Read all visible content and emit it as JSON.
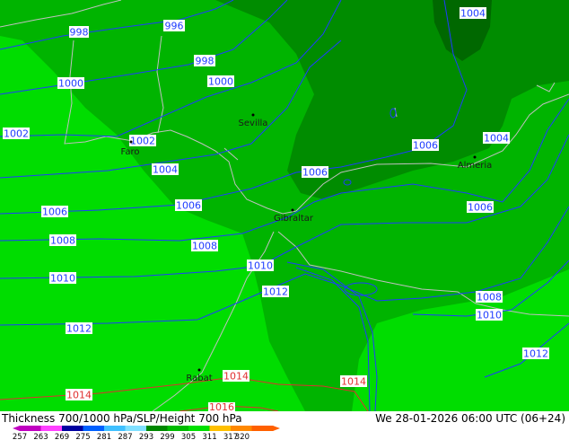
{
  "map": {
    "isobar_labels": [
      "998",
      "996",
      "998",
      "1000",
      "1000",
      "1002",
      "1002",
      "1004",
      "1004",
      "1004",
      "1006",
      "1006",
      "1006",
      "1006",
      "1006",
      "1008",
      "1008",
      "1008",
      "1010",
      "1010",
      "1010",
      "1012",
      "1012",
      "1012",
      "1014",
      "1014",
      "1014",
      "1016"
    ],
    "cities": [
      "Sevilla",
      "Faro",
      "Almeria",
      "Gibraltar",
      "Rabat"
    ]
  },
  "footer": {
    "product_title": "Thickness 700/1000 hPa/SLP/Height 700 hPa",
    "valid_time": "We 28-01-2026 06:00 UTC (06+24)"
  },
  "legend": {
    "ticks": [
      "257",
      "263",
      "269",
      "275",
      "281",
      "287",
      "293",
      "299",
      "305",
      "311",
      "317",
      "320"
    ],
    "colors": [
      "#c000c0",
      "#ff40ff",
      "#0000a0",
      "#0060ff",
      "#40c0ff",
      "#80e0ff",
      "#008800",
      "#00bb00",
      "#00e000",
      "#ffc000",
      "#ff8800",
      "#ff6000"
    ]
  },
  "colors": {
    "green_light": "#00dd00",
    "green_mid": "#00b400",
    "green_dark": "#008c00",
    "green_darkest": "#006800",
    "isobar": "#1e3cff",
    "isobar_high": "#e03030",
    "coast": "#c0c0c0"
  }
}
